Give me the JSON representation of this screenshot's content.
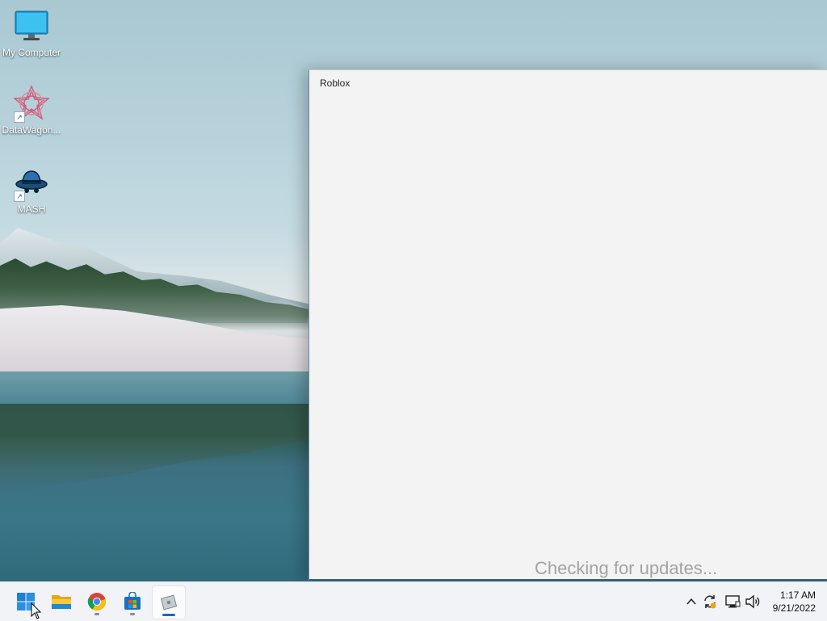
{
  "desktop": {
    "icons": [
      {
        "label": "My Computer",
        "icon": "monitor-icon"
      },
      {
        "label": "DataWagon...",
        "icon": "datawagon-icon",
        "shortcut": true
      },
      {
        "label": "MASH",
        "icon": "mash-icon",
        "shortcut": true
      }
    ]
  },
  "roblox_window": {
    "title": "Roblox",
    "status": "Checking for updates..."
  },
  "taskbar": {
    "apps": [
      {
        "name": "Start",
        "icon": "windows-start-icon"
      },
      {
        "name": "File Explorer",
        "icon": "folder-icon"
      },
      {
        "name": "Google Chrome",
        "icon": "chrome-icon"
      },
      {
        "name": "Microsoft Store",
        "icon": "store-icon"
      },
      {
        "name": "Roblox",
        "icon": "roblox-icon"
      }
    ],
    "tray": {
      "icons": [
        "chevron-up-icon",
        "sync-icon",
        "network-icon",
        "volume-icon"
      ]
    },
    "clock": {
      "time": "1:17 AM",
      "date": "9/21/2022"
    }
  },
  "colors": {
    "taskbar_bg": "#f1f3f6",
    "window_bg": "#f3f3f3",
    "status_text": "#a3a3a3",
    "accent": "#0f6cbd"
  }
}
